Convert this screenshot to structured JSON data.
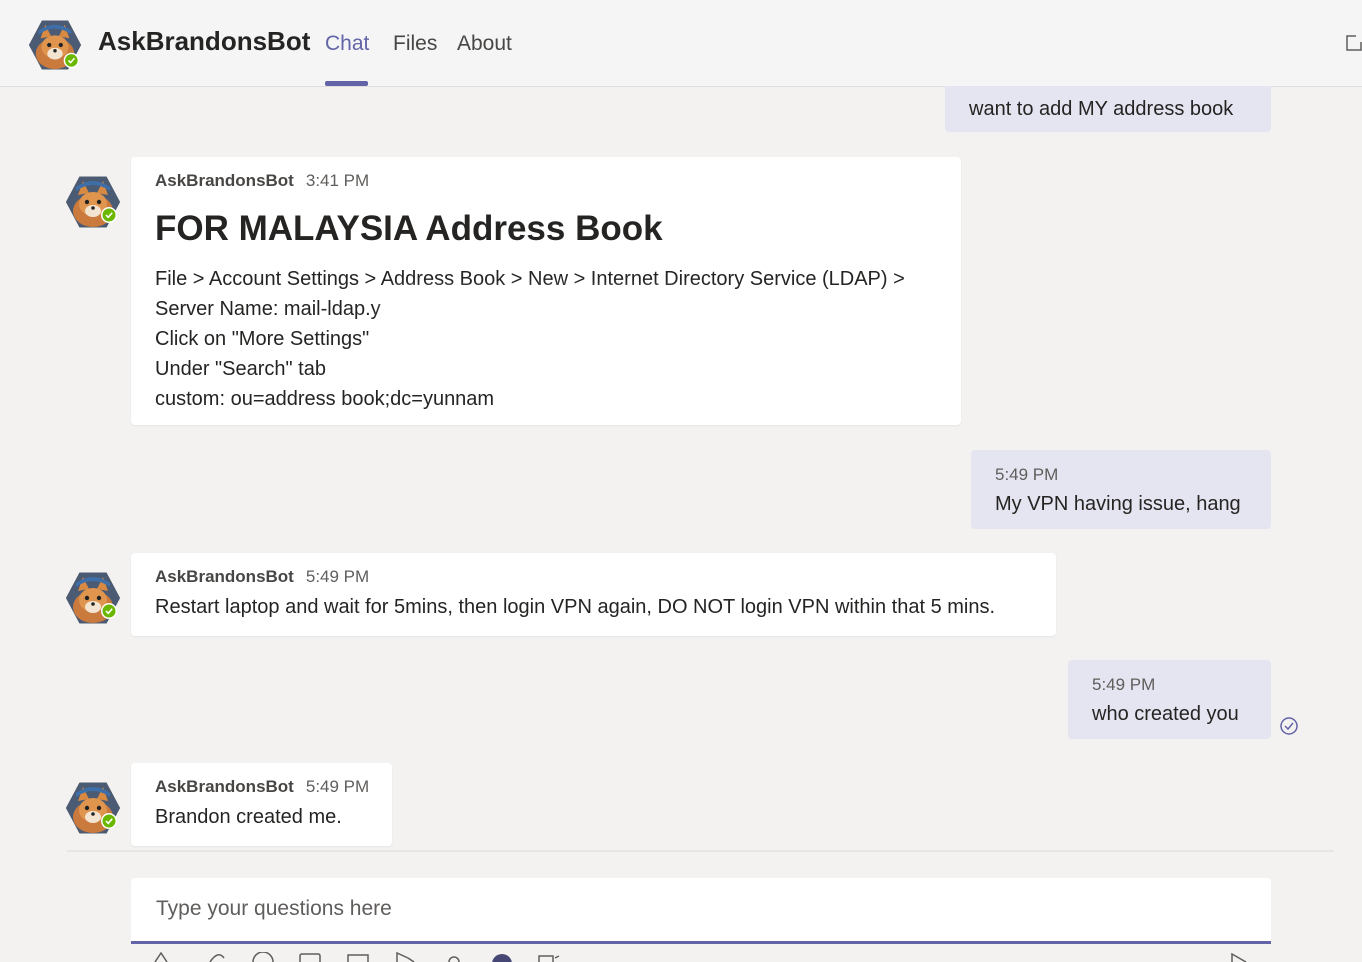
{
  "header": {
    "title": "AskBrandonsBot",
    "tabs": [
      {
        "label": "Chat",
        "active": true
      },
      {
        "label": "Files",
        "active": false
      },
      {
        "label": "About",
        "active": false
      }
    ]
  },
  "accent_color": "#6264a7",
  "status_color": "#6bb700",
  "messages": [
    {
      "from": "me",
      "text": "want to add MY address book"
    },
    {
      "from": "bot",
      "sender": "AskBrandonsBot",
      "time": "3:41 PM",
      "heading": "FOR MALAYSIA Address Book",
      "lines": [
        "File > Account Settings > Address Book > New > Internet Directory Service (LDAP) >",
        "Server Name: mail-ldap.y",
        "Click on \"More Settings\"",
        "Under \"Search\" tab",
        "custom: ou=address book;dc=yunnam"
      ]
    },
    {
      "from": "me",
      "time": "5:49 PM",
      "text": "My VPN having issue, hang"
    },
    {
      "from": "bot",
      "sender": "AskBrandonsBot",
      "time": "5:49 PM",
      "text": "Restart laptop and wait for 5mins, then login VPN again, DO NOT login VPN within that 5 mins."
    },
    {
      "from": "me",
      "time": "5:49 PM",
      "text": "who created you"
    },
    {
      "from": "bot",
      "sender": "AskBrandonsBot",
      "time": "5:49 PM",
      "text": "Brandon created me."
    }
  ],
  "compose": {
    "placeholder": "Type your questions here"
  },
  "icons": [
    "bot-avatar-icon",
    "status-available-icon",
    "popout-icon",
    "read-receipt-icon",
    "format-icon",
    "attach-icon",
    "emoji-icon",
    "gif-icon",
    "sticker-icon",
    "meet-icon",
    "location-icon",
    "send-icon"
  ]
}
